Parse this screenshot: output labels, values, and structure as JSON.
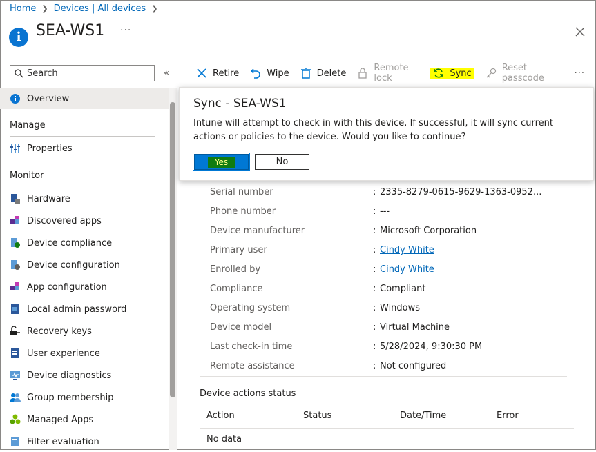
{
  "breadcrumb": [
    {
      "label": "Home"
    },
    {
      "label": "Devices | All devices"
    }
  ],
  "page": {
    "title": "SEA-WS1",
    "more": "···"
  },
  "search": {
    "placeholder": "Search"
  },
  "sidebar": {
    "overview": "Overview",
    "manage_header": "Manage",
    "properties": "Properties",
    "monitor_header": "Monitor",
    "monitor_items": [
      {
        "label": "Hardware",
        "icon": "hardware-icon"
      },
      {
        "label": "Discovered apps",
        "icon": "apps-icon"
      },
      {
        "label": "Device compliance",
        "icon": "compliance-icon"
      },
      {
        "label": "Device configuration",
        "icon": "configuration-icon"
      },
      {
        "label": "App configuration",
        "icon": "app-config-icon"
      },
      {
        "label": "Local admin password",
        "icon": "password-icon"
      },
      {
        "label": "Recovery keys",
        "icon": "key-icon"
      },
      {
        "label": "User experience",
        "icon": "user-experience-icon"
      },
      {
        "label": "Device diagnostics",
        "icon": "diagnostics-icon"
      },
      {
        "label": "Group membership",
        "icon": "group-icon"
      },
      {
        "label": "Managed Apps",
        "icon": "managed-apps-icon"
      },
      {
        "label": "Filter evaluation",
        "icon": "filter-icon"
      }
    ]
  },
  "toolbar": {
    "retire": "Retire",
    "wipe": "Wipe",
    "delete": "Delete",
    "remote_lock": "Remote lock",
    "sync": "Sync",
    "reset_passcode": "Reset passcode",
    "more": "···"
  },
  "dialog": {
    "title": "Sync - SEA-WS1",
    "message": "Intune will attempt to check in with this device. If successful, it will sync current actions or policies to the device. Would you like to continue?",
    "yes": "Yes",
    "no": "No"
  },
  "properties": [
    {
      "label": "Serial number",
      "value": "2335-8279-0615-9629-1363-0952..."
    },
    {
      "label": "Phone number",
      "value": "---"
    },
    {
      "label": "Device manufacturer",
      "value": "Microsoft Corporation"
    },
    {
      "label": "Primary user",
      "value": "Cindy White",
      "link": true
    },
    {
      "label": "Enrolled by",
      "value": "Cindy White",
      "link": true
    },
    {
      "label": "Compliance",
      "value": "Compliant"
    },
    {
      "label": "Operating system",
      "value": "Windows"
    },
    {
      "label": "Device model",
      "value": "Virtual Machine"
    },
    {
      "label": "Last check-in time",
      "value": "5/28/2024, 9:30:30 PM"
    },
    {
      "label": "Remote assistance",
      "value": "Not configured"
    }
  ],
  "actions_status": {
    "title": "Device actions status",
    "columns": [
      "Action",
      "Status",
      "Date/Time",
      "Error"
    ],
    "empty": "No data"
  },
  "colors": {
    "accent": "#0078d4",
    "link": "#0067b8",
    "highlight": "#ffff00"
  }
}
